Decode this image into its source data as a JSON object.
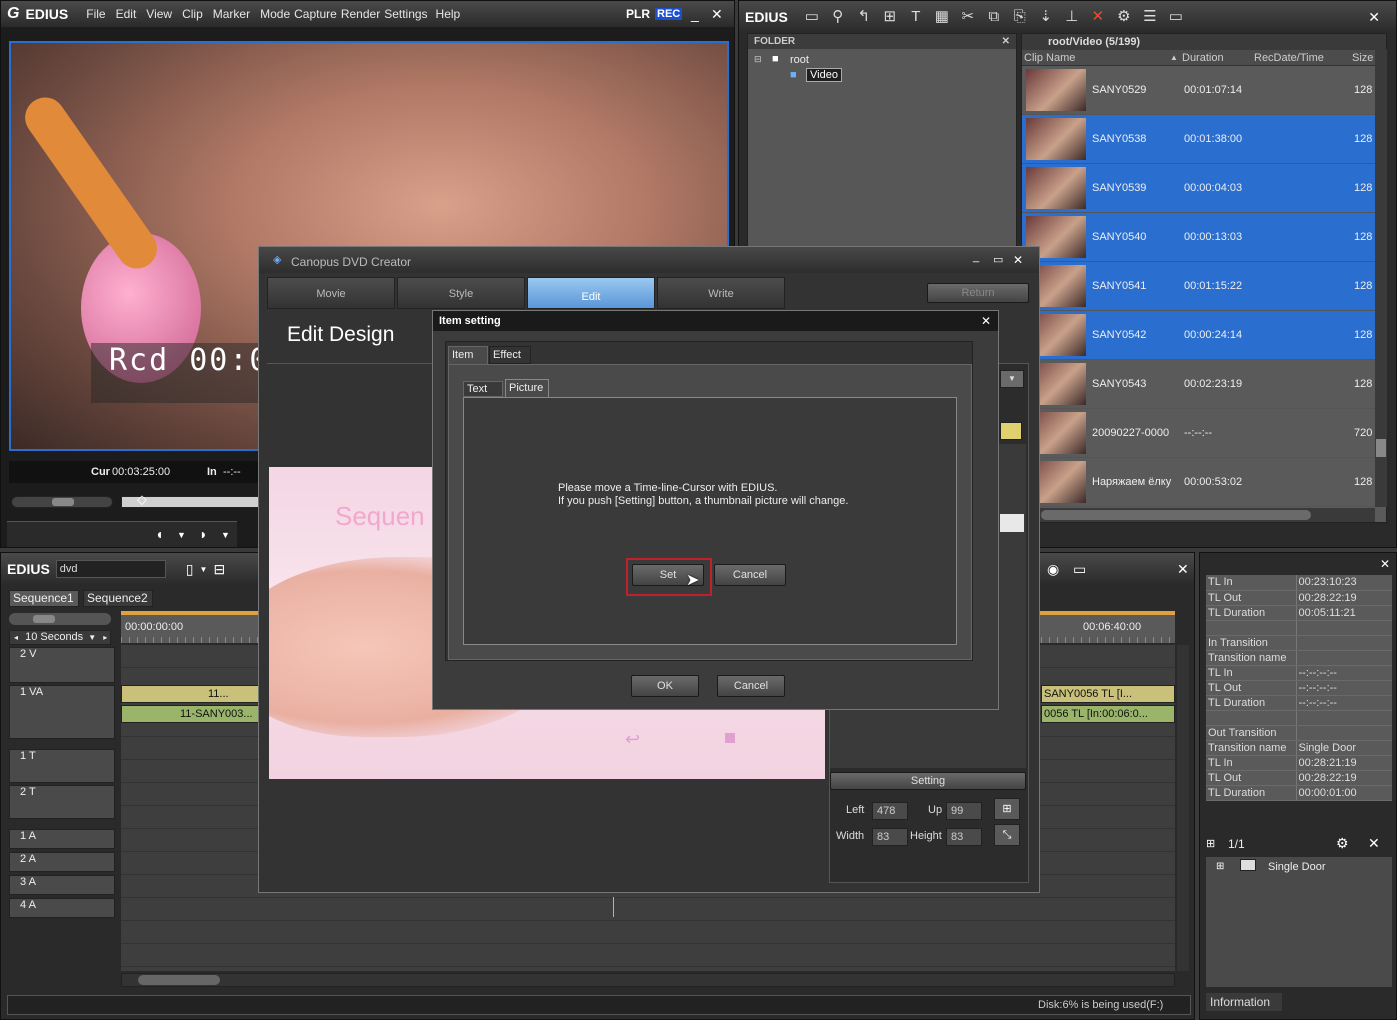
{
  "player": {
    "logo": "EDIUS",
    "menu": [
      "File",
      "Edit",
      "View",
      "Clip",
      "Marker",
      "Mode",
      "Capture",
      "Render",
      "Settings",
      "Help"
    ],
    "plr": "PLR",
    "rec": "REC",
    "timecode_overlay": "Rcd 00:0",
    "cur_label": "Cur",
    "cur_value": "00:03:25:00",
    "in_label": "In",
    "in_value": "--:--"
  },
  "bin": {
    "logo": "EDIUS",
    "folder_header": "FOLDER",
    "root": "root",
    "video": "Video",
    "path": "root/Video (5/199)",
    "columns": [
      "Clip Name",
      "Duration",
      "RecDate/Time",
      "Size"
    ],
    "clips": [
      {
        "name": "SANY0529",
        "duration": "00:01:07:14",
        "size": "128",
        "selected": false
      },
      {
        "name": "SANY0538",
        "duration": "00:01:38:00",
        "size": "128",
        "selected": true
      },
      {
        "name": "SANY0539",
        "duration": "00:00:04:03",
        "size": "128",
        "selected": true
      },
      {
        "name": "SANY0540",
        "duration": "00:00:13:03",
        "size": "128",
        "selected": true
      },
      {
        "name": "SANY0541",
        "duration": "00:01:15:22",
        "size": "128",
        "selected": true
      },
      {
        "name": "SANY0542",
        "duration": "00:00:24:14",
        "size": "128",
        "selected": true
      },
      {
        "name": "SANY0543",
        "duration": "00:02:23:19",
        "size": "128",
        "selected": false
      },
      {
        "name": "20090227-0000",
        "duration": "--:--:--",
        "size": "720",
        "selected": false
      },
      {
        "name": "Наряжаем ёлку",
        "duration": "00:00:53:02",
        "size": "128",
        "selected": false
      }
    ]
  },
  "timeline": {
    "logo": "EDIUS",
    "project": "dvd",
    "tabs": [
      "Sequence1",
      "Sequence2"
    ],
    "scale": "10 Seconds",
    "tc_start": "00:00:00:00",
    "tc_end": "00:06:40:00",
    "tracks": [
      "2 V",
      "1 VA",
      "1 T",
      "2 T",
      "1 A",
      "2 A",
      "3 A",
      "4 A"
    ],
    "clip_a": "11...",
    "clip_b": "11-SANY003...",
    "clip_c": "SANY0056  TL [I...",
    "clip_d": "0056  TL [In:00:06:0..."
  },
  "info": {
    "rows": [
      [
        "TL In",
        "00:23:10:23"
      ],
      [
        "TL Out",
        "00:28:22:19"
      ],
      [
        "TL Duration",
        "00:05:11:21"
      ],
      [
        "",
        ""
      ],
      [
        "In Transition",
        ""
      ],
      [
        "Transition name",
        ""
      ],
      [
        "TL In",
        "--:--:--:--"
      ],
      [
        "TL Out",
        "--:--:--:--"
      ],
      [
        "TL Duration",
        "--:--:--:--"
      ],
      [
        "",
        ""
      ],
      [
        "Out Transition",
        ""
      ],
      [
        "Transition name",
        "Single Door"
      ],
      [
        "TL In",
        "00:28:21:19"
      ],
      [
        "TL Out",
        "00:28:22:19"
      ],
      [
        "TL Duration",
        "00:00:01:00"
      ]
    ],
    "page": "1/1",
    "effect": "Single Door",
    "tab": "Information"
  },
  "status": {
    "disk": "Disk:6% is being used(F:)"
  },
  "dvd": {
    "title": "Canopus DVD Creator",
    "tabs": [
      "Movie",
      "Style",
      "Edit",
      "Write"
    ],
    "return": "Return",
    "heading": "Edit Design",
    "preview_text": "Sequen",
    "setting": "Setting",
    "left_label": "Left",
    "left": "478",
    "up_label": "Up",
    "up": "99",
    "width_label": "Width",
    "width": "83",
    "height_label": "Height",
    "height": "83"
  },
  "dialog": {
    "title": "Item setting",
    "tabs": [
      "Item",
      "Effect"
    ],
    "subtabs": [
      "Text",
      "Picture"
    ],
    "message1": "Please move a Time-line-Cursor with EDIUS.",
    "message2": "If you push [Setting] button, a thumbnail picture will change.",
    "set": "Set",
    "cancel_inner": "Cancel",
    "ok": "OK",
    "cancel": "Cancel"
  }
}
